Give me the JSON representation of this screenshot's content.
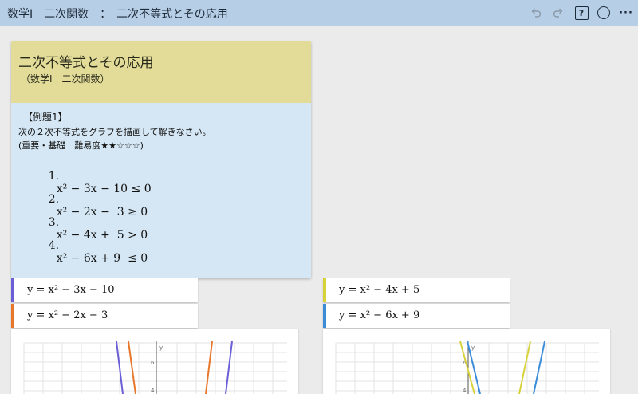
{
  "header": {
    "title": "数学Ⅰ　二次関数　：　二次不等式とその応用",
    "help_label": "?",
    "more_label": "···"
  },
  "card": {
    "title": "二次不等式とその応用",
    "subtitle": "（数学Ⅰ　二次関数）",
    "example_title": "【例題1】",
    "description": "次の２次不等式をグラフを描画して解きなさい。",
    "meta": "(重要・基礎　難易度★★☆☆☆)",
    "problems": [
      {
        "num": "1.",
        "expr": "x² − 3x − 10 ≤ 0"
      },
      {
        "num": "2.",
        "expr": "x² − 2x −  3 ≥ 0"
      },
      {
        "num": "3.",
        "expr": "x² − 4x +  5 > 0"
      },
      {
        "num": "4.",
        "expr": "x² − 6x + 9  ≤ 0"
      }
    ]
  },
  "equations": [
    {
      "text": "y = x² − 3x − 10",
      "color": "#6a5fd6"
    },
    {
      "text": "y = x² − 2x − 3",
      "color": "#e8762b"
    },
    {
      "text": "y = x² − 4x + 5",
      "color": "#d8d23a"
    },
    {
      "text": "y = x² − 6x + 9",
      "color": "#3a8cd8"
    }
  ],
  "graphs": [
    {
      "axis_label": "y",
      "ticks": [
        "6",
        "4"
      ]
    },
    {
      "axis_label": "y",
      "ticks": [
        "6",
        "4"
      ]
    }
  ],
  "colors": {
    "topbar": "#b7cfe6",
    "card_header": "#e2dc98",
    "card_body": "#d5e7f4"
  }
}
